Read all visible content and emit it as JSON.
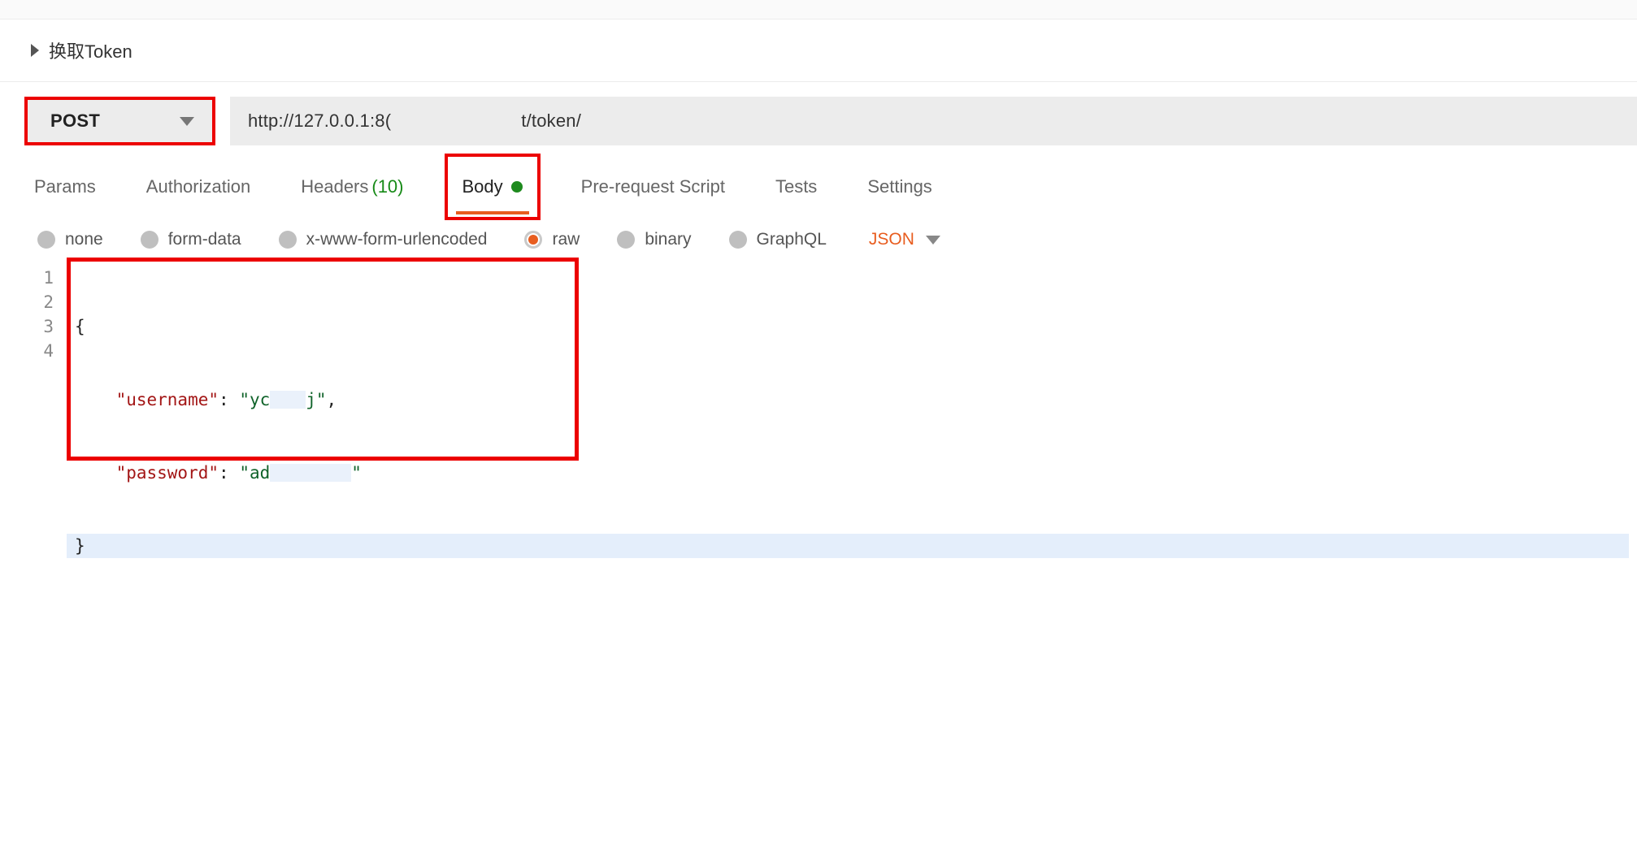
{
  "request": {
    "name": "换取Token",
    "method": "POST",
    "url_prefix": "http://127.0.0.1:8(",
    "url_suffix": "t/token/"
  },
  "tabs": {
    "params": "Params",
    "authorization": "Authorization",
    "headers": "Headers",
    "headers_count": "(10)",
    "body": "Body",
    "prerequest": "Pre-request Script",
    "tests": "Tests",
    "settings": "Settings"
  },
  "body_modes": {
    "none": "none",
    "form_data": "form-data",
    "xwww": "x-www-form-urlencoded",
    "raw": "raw",
    "binary": "binary",
    "graphql": "GraphQL",
    "language": "JSON"
  },
  "editor": {
    "lines": [
      "1",
      "2",
      "3",
      "4"
    ],
    "code": {
      "open": "{",
      "username_key": "\"username\"",
      "username_val_prefix": "\"yc",
      "username_val_suffix": "j\"",
      "password_key": "\"password\"",
      "password_val_prefix": "\"ad",
      "password_val_suffix": "\"",
      "close": "}"
    }
  }
}
